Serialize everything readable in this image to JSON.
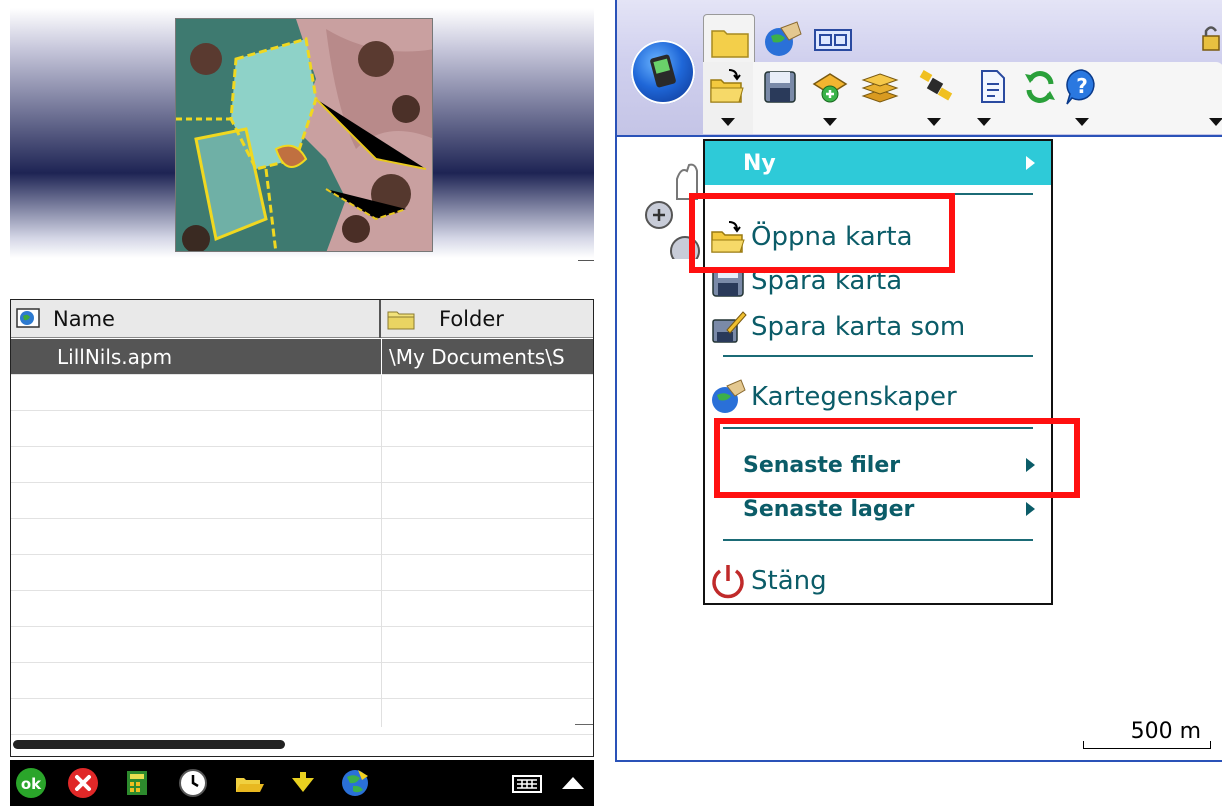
{
  "left_panel": {
    "filelist": {
      "columns": [
        {
          "label": "Name"
        },
        {
          "label": "Folder"
        }
      ],
      "rows": [
        {
          "name": "LillNils.apm",
          "folder": "\\My Documents\\S"
        }
      ]
    }
  },
  "right_panel": {
    "menu": {
      "new": "Ny",
      "open_map": "Öppna karta",
      "save_map": "Spara karta",
      "save_map_as": "Spara karta som",
      "map_properties": "Kartegenskaper",
      "recent_files": "Senaste filer",
      "recent_layers": "Senaste lager",
      "close": "Stäng"
    },
    "scale_label": "500 m"
  },
  "colors": {
    "menu_header": "#2ecad8",
    "menu_text": "#0b5c68",
    "highlight": "#ff1010",
    "selected_row": "#555555",
    "border_blue": "#2a52b8"
  }
}
